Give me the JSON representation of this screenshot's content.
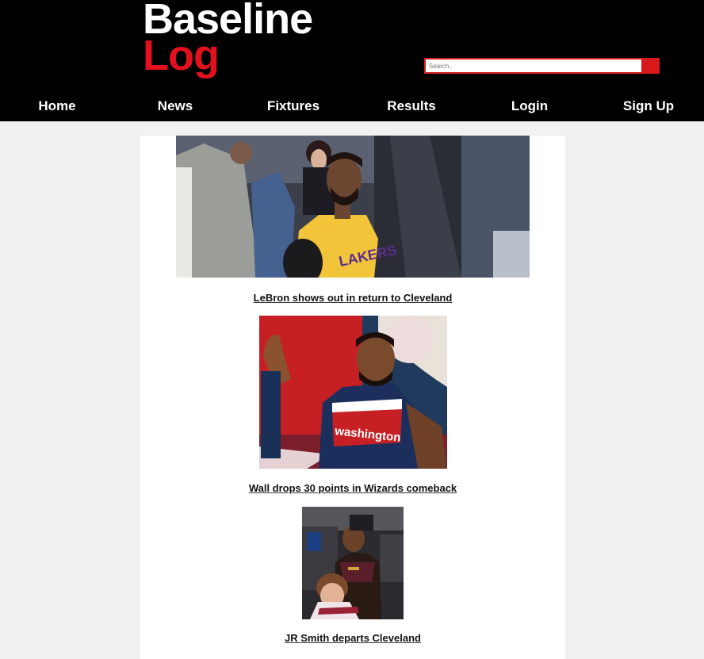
{
  "site": {
    "logo_line1": "Baseline",
    "logo_line2": "Log",
    "logo_line1_color": "#ffffff",
    "logo_line2_color": "#e3101e"
  },
  "search": {
    "placeholder": "Search..",
    "button_color": "#d81a1a"
  },
  "nav": {
    "items": [
      {
        "label": "Home"
      },
      {
        "label": "News"
      },
      {
        "label": "Fixtures"
      },
      {
        "label": "Results"
      },
      {
        "label": "Login"
      },
      {
        "label": "Sign Up"
      }
    ]
  },
  "articles": [
    {
      "title": "LeBron shows out in return to Cleveland",
      "photo": "lebron-photo"
    },
    {
      "title": "Wall drops 30 points in Wizards comeback",
      "photo": "wall-photo"
    },
    {
      "title": "JR Smith departs Cleveland",
      "photo": "jr-smith-photo"
    }
  ],
  "colors": {
    "header_bg": "#000000",
    "page_bg": "#f1f1f0",
    "content_bg": "#ffffff",
    "accent": "#e3101e"
  }
}
